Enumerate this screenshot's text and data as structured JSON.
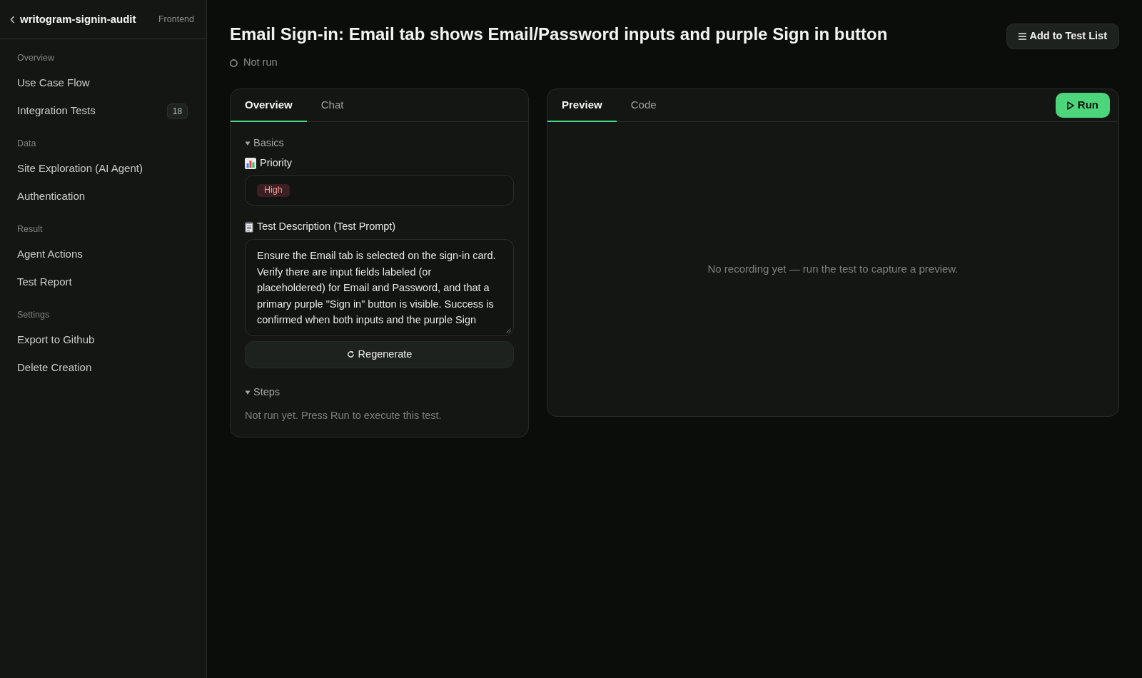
{
  "sidebar": {
    "project_name": "writogram-signin-audit",
    "tag": "Frontend",
    "sections": [
      {
        "label": "Overview",
        "items": [
          {
            "label": "Use Case Flow",
            "selected": false
          },
          {
            "label": "Integration Tests",
            "count": "18",
            "selected": false
          }
        ]
      },
      {
        "label": "Data",
        "items": [
          {
            "label": "Site Exploration (AI Agent)",
            "selected": false
          },
          {
            "label": "Authentication",
            "selected": false
          }
        ]
      },
      {
        "label": "Result",
        "items": [
          {
            "label": "Agent Actions",
            "selected": false
          },
          {
            "label": "Test Report",
            "selected": false
          }
        ]
      },
      {
        "label": "Settings",
        "items": [
          {
            "label": "Export to Github",
            "selected": false
          },
          {
            "label": "Delete Creation",
            "selected": false
          }
        ]
      }
    ]
  },
  "header": {
    "title": "Email Sign-in: Email tab shows Email/Password inputs and purple Sign in button",
    "status": {
      "kind": "not_run",
      "label": "Not run"
    },
    "add_button": "Add to Test List"
  },
  "details_panel": {
    "tabs": [
      {
        "label": "Overview",
        "selected": true
      },
      {
        "label": "Chat",
        "selected": false
      }
    ],
    "basics": {
      "title": "Basics",
      "expanded": true,
      "priority": {
        "label": "Priority",
        "value": "High"
      },
      "description": {
        "label": "Test Description (Test Prompt)",
        "value": "Ensure the Email tab is selected on the sign-in card. Verify there are input fields labeled (or placeholdered) for Email and Password, and that a primary purple \"Sign in\" button is visible. Success is confirmed when both inputs and the purple Sign"
      },
      "regenerate_button": "Regenerate"
    },
    "steps": {
      "title": "Steps",
      "expanded": true,
      "message": "Not run yet. Press Run to execute this test."
    }
  },
  "preview_panel": {
    "tabs": [
      {
        "label": "Preview",
        "selected": true
      },
      {
        "label": "Code",
        "selected": false
      }
    ],
    "run_button": "Run",
    "empty_message": "No recording yet — run the test to capture a preview."
  }
}
